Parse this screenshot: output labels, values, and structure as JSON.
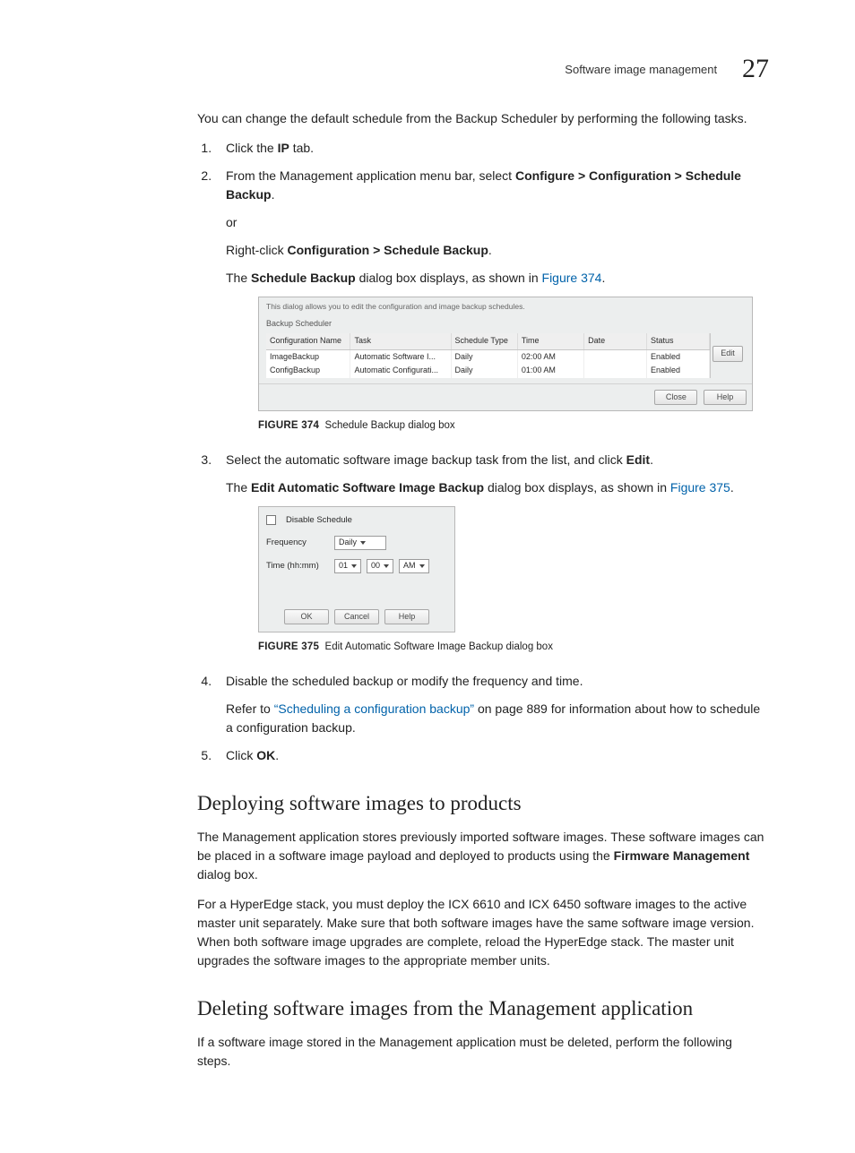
{
  "header": {
    "topic": "Software image management",
    "chapter": "27"
  },
  "intro": "You can change the default schedule from the Backup Scheduler by performing the following tasks.",
  "steps": {
    "s1_a": "Click the ",
    "s1_bold": "IP",
    "s1_b": " tab.",
    "s2_a": "From the Management application menu bar, select ",
    "s2_bold": "Configure > Configuration > Schedule Backup",
    "s2_b": ".",
    "s2_or": "or",
    "s2_rc_a": "Right-click ",
    "s2_rc_bold": "Configuration > Schedule Backup",
    "s2_rc_b": ".",
    "s2_res_a": "The ",
    "s2_res_bold": "Schedule Backup",
    "s2_res_b": " dialog box displays, as shown in ",
    "s2_res_link": "Figure 374",
    "s2_res_c": ".",
    "s3_a": "Select the automatic software image backup task from the list, and click ",
    "s3_bold": "Edit",
    "s3_b": ".",
    "s3_res_a": "The ",
    "s3_res_bold": "Edit Automatic Software Image Backup",
    "s3_res_b": " dialog box displays, as shown in ",
    "s3_res_link": "Figure 375",
    "s3_res_c": ".",
    "s4": "Disable the scheduled backup or modify the frequency and time.",
    "s4_ref_a": "Refer to ",
    "s4_ref_link": "“Scheduling a configuration backup”",
    "s4_ref_b": " on page 889 for information about how to schedule a configuration backup.",
    "s5_a": "Click ",
    "s5_bold": "OK",
    "s5_b": "."
  },
  "fig374": {
    "caption_num": "FIGURE 374",
    "caption_txt": "Schedule Backup dialog box",
    "tiny": "This dialog allows you to edit the configuration and image backup schedules.",
    "panel": "Backup Scheduler",
    "cols": [
      "Configuration Name",
      "Task",
      "Schedule Type",
      "Time",
      "Date",
      "Status"
    ],
    "row1": [
      "ImageBackup",
      "Automatic Software I...",
      "Daily",
      "02:00 AM",
      "",
      "Enabled"
    ],
    "row2": [
      "ConfigBackup",
      "Automatic Configurati...",
      "Daily",
      "01:00 AM",
      "",
      "Enabled"
    ],
    "edit": "Edit",
    "close": "Close",
    "help": "Help"
  },
  "fig375": {
    "caption_num": "FIGURE 375",
    "caption_txt": "Edit Automatic Software Image Backup dialog box",
    "disable": "Disable Schedule",
    "freq_label": "Frequency",
    "freq_val": "Daily",
    "time_label": "Time (hh:mm)",
    "hh": "01",
    "mm": "00",
    "ampm": "AM",
    "ok": "OK",
    "cancel": "Cancel",
    "help": "Help"
  },
  "deploy": {
    "heading": "Deploying software images to products",
    "p1_a": "The Management application stores previously imported software images. These software images can be placed in a software image payload and deployed to products using the ",
    "p1_bold": "Firmware Management",
    "p1_b": " dialog box.",
    "p2": "For a HyperEdge stack, you must deploy the ICX 6610 and ICX 6450 software images to the active master unit separately. Make sure that both software images have the same software image version. When both software image upgrades are complete, reload the HyperEdge stack. The master unit upgrades the software images to the appropriate member units."
  },
  "delete": {
    "heading": "Deleting software images from the Management application",
    "p1": "If a software image stored in the Management application must be deleted, perform the following steps."
  }
}
